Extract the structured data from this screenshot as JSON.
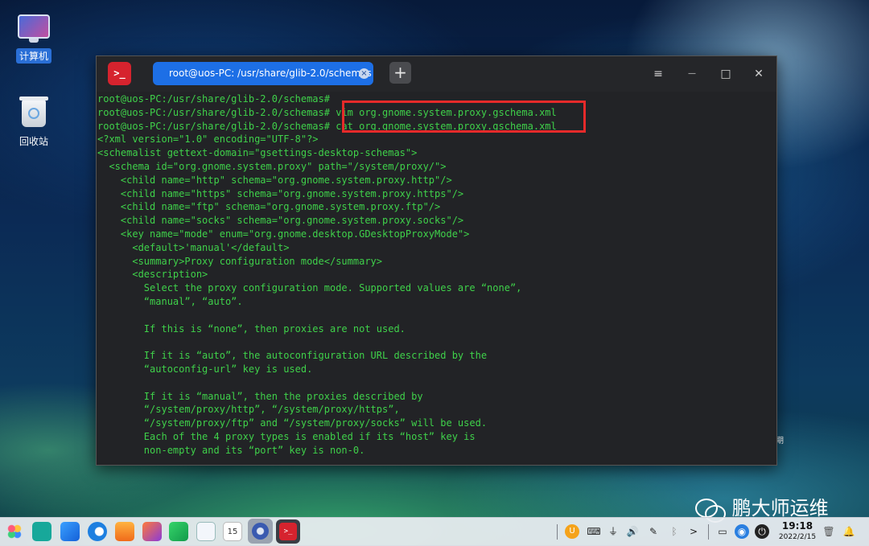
{
  "desktop": {
    "icons": [
      {
        "label": "计算机",
        "icon": "computer-icon"
      },
      {
        "label": "回收站",
        "icon": "trash-icon"
      }
    ],
    "watermark": "鹏大师运维",
    "side_text": "期"
  },
  "terminal_window": {
    "tab_title": "root@uos-PC: /usr/share/glib-2.0/schemas",
    "app_icon_text": ">_",
    "new_tab_label": "+",
    "close_tab_label": "×",
    "menu_label": "≡",
    "minimize_label": "—",
    "maximize_label": "□",
    "close_label": "✕",
    "lines": [
      "root@uos-PC:/usr/share/glib-2.0/schemas#",
      "root@uos-PC:/usr/share/glib-2.0/schemas# vim org.gnome.system.proxy.gschema.xml",
      "root@uos-PC:/usr/share/glib-2.0/schemas# cat org.gnome.system.proxy.gschema.xml",
      "<?xml version=\"1.0\" encoding=\"UTF-8\"?>",
      "<schemalist gettext-domain=\"gsettings-desktop-schemas\">",
      "  <schema id=\"org.gnome.system.proxy\" path=\"/system/proxy/\">",
      "    <child name=\"http\" schema=\"org.gnome.system.proxy.http\"/>",
      "    <child name=\"https\" schema=\"org.gnome.system.proxy.https\"/>",
      "    <child name=\"ftp\" schema=\"org.gnome.system.proxy.ftp\"/>",
      "    <child name=\"socks\" schema=\"org.gnome.system.proxy.socks\"/>",
      "    <key name=\"mode\" enum=\"org.gnome.desktop.GDesktopProxyMode\">",
      "      <default>'manual'</default>",
      "      <summary>Proxy configuration mode</summary>",
      "      <description>",
      "        Select the proxy configuration mode. Supported values are “none”,",
      "        “manual”, “auto”.",
      "",
      "        If this is “none”, then proxies are not used.",
      "",
      "        If it is “auto”, the autoconfiguration URL described by the",
      "        “autoconfig-url” key is used.",
      "",
      "        If it is “manual”, then the proxies described by",
      "        “/system/proxy/http”, “/system/proxy/https”,",
      "        “/system/proxy/ftp” and “/system/proxy/socks” will be used.",
      "        Each of the 4 proxy types is enabled if its “host” key is",
      "        non-empty and its “port” key is non-0."
    ]
  },
  "taskbar": {
    "launchers": [
      "launcher-icon",
      "multitask-view-icon",
      "app-store-icon",
      "browser-icon",
      "file-manager-icon",
      "image-viewer-icon",
      "music-icon",
      "document-viewer-icon",
      "calendar-icon",
      "settings-icon",
      "terminal-icon"
    ],
    "calendar_day": "15",
    "tray": [
      "input-method-icon",
      "keyboard-icon",
      "usb-icon",
      "volume-icon",
      "pen-icon",
      "bluetooth-icon",
      "expand-icon",
      "screen-icon",
      "network-icon",
      "power-icon",
      "trash-icon",
      "notification-icon"
    ],
    "expand_label": ">",
    "time": "19:18",
    "date": "2022/2/15"
  }
}
